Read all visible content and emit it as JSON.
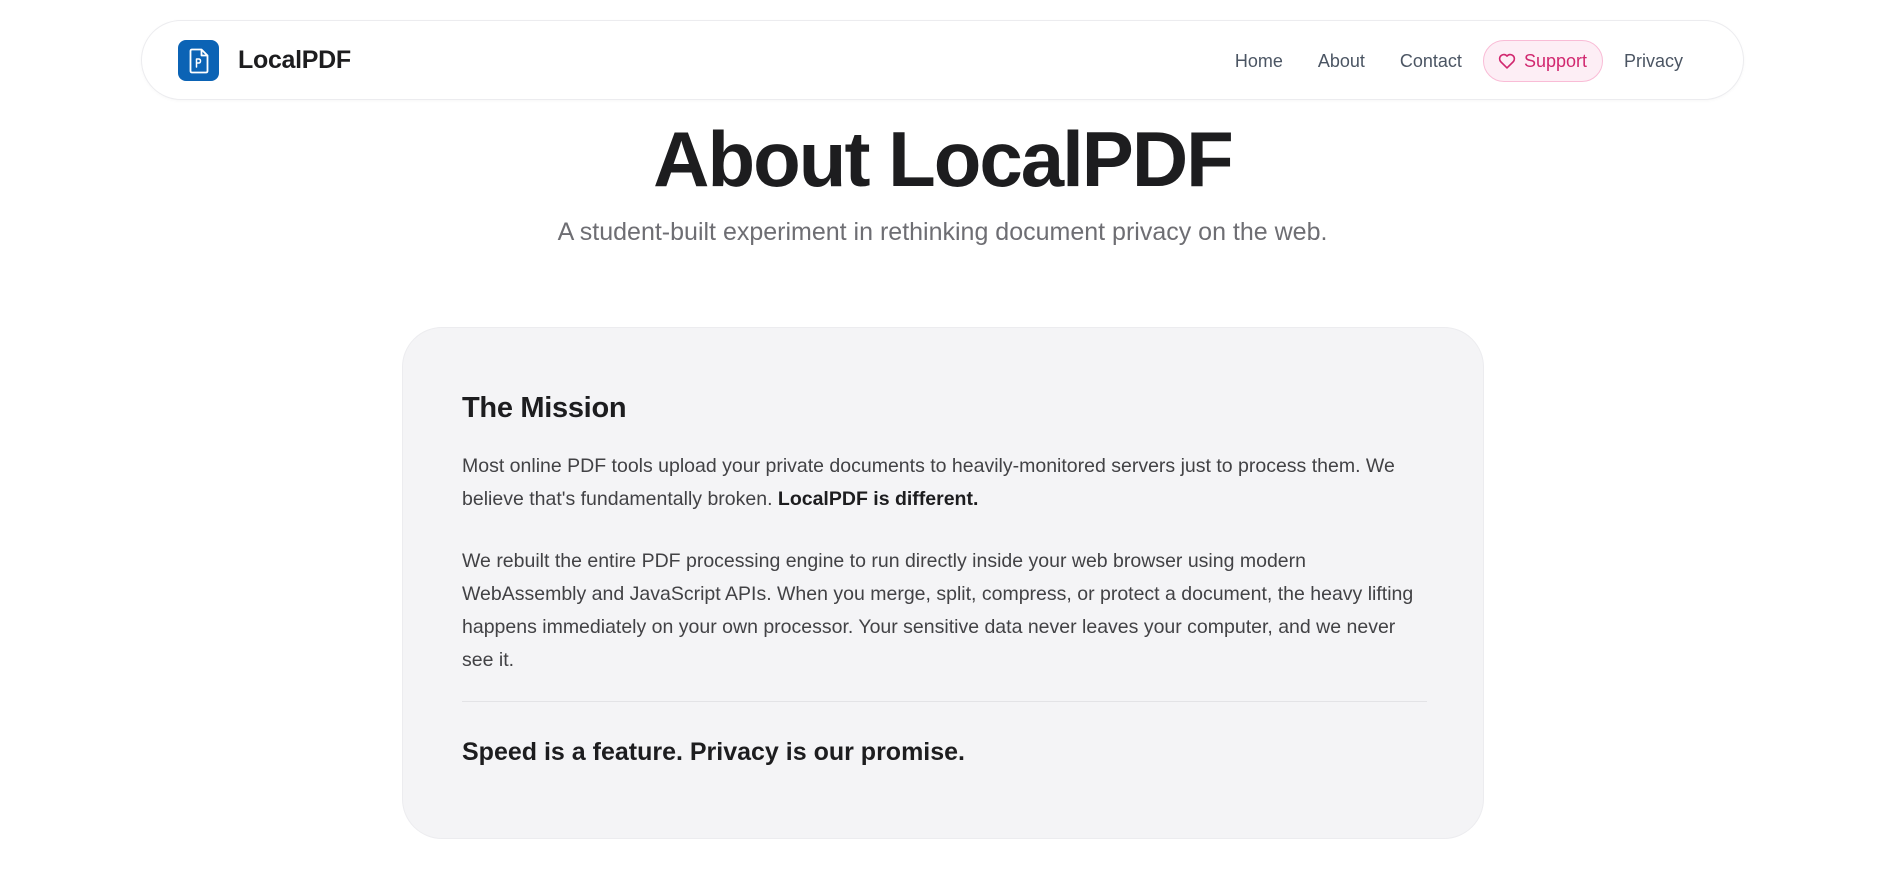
{
  "brand": {
    "name": "LocalPDF",
    "icon": "pdf-file-icon",
    "color": "#0b63b5"
  },
  "nav": {
    "home": "Home",
    "about": "About",
    "contact": "Contact",
    "support": "Support",
    "support_icon": "heart-icon",
    "privacy": "Privacy",
    "accent": "#d1286f"
  },
  "hero": {
    "title": "About LocalPDF",
    "subtitle": "A student-built experiment in rethinking document privacy on the web."
  },
  "mission": {
    "heading": "The Mission",
    "p1_text": "Most online PDF tools upload your private documents to heavily-monitored servers just to process them. We believe that's fundamentally broken. ",
    "p1_bold": "LocalPDF is different.",
    "p2": "We rebuilt the entire PDF processing engine to run directly inside your web browser using modern WebAssembly and JavaScript APIs. When you merge, split, compress, or protect a document, the heavy lifting happens immediately on your own processor. Your sensitive data never leaves your computer, and we never see it.",
    "promise": "Speed is a feature. Privacy is our promise."
  }
}
